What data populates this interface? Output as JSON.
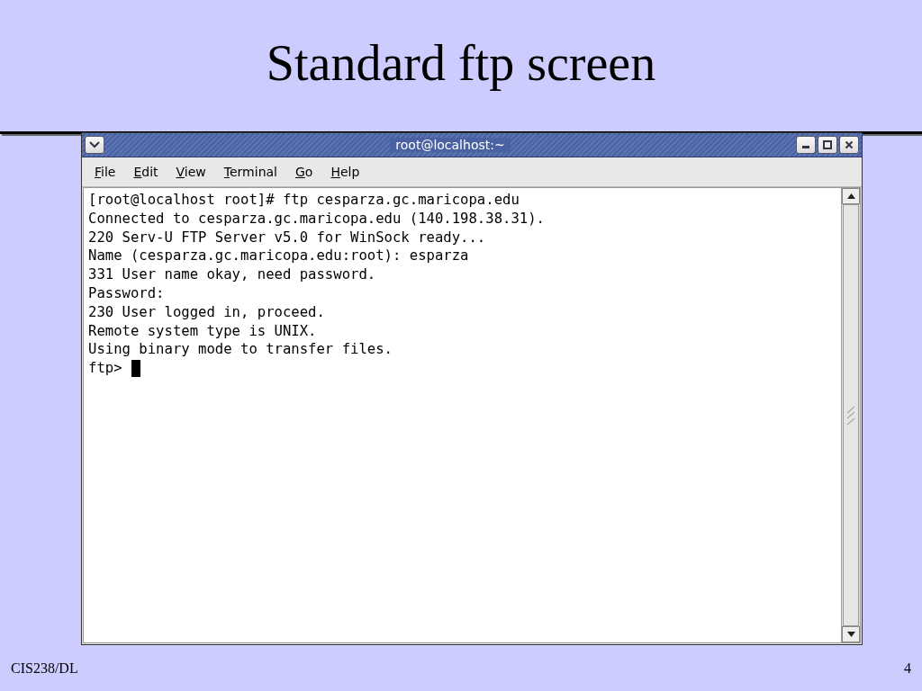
{
  "slide": {
    "title": "Standard ftp screen",
    "footer_left": "CIS238/DL",
    "page_number": "4"
  },
  "window": {
    "title": "root@localhost:~"
  },
  "menu": [
    "File",
    "Edit",
    "View",
    "Terminal",
    "Go",
    "Help"
  ],
  "terminal": {
    "lines": [
      "[root@localhost root]# ftp cesparza.gc.maricopa.edu",
      "Connected to cesparza.gc.maricopa.edu (140.198.38.31).",
      "220 Serv-U FTP Server v5.0 for WinSock ready...",
      "Name (cesparza.gc.maricopa.edu:root): esparza",
      "331 User name okay, need password.",
      "Password:",
      "230 User logged in, proceed.",
      "Remote system type is UNIX.",
      "Using binary mode to transfer files."
    ],
    "prompt": "ftp>"
  }
}
